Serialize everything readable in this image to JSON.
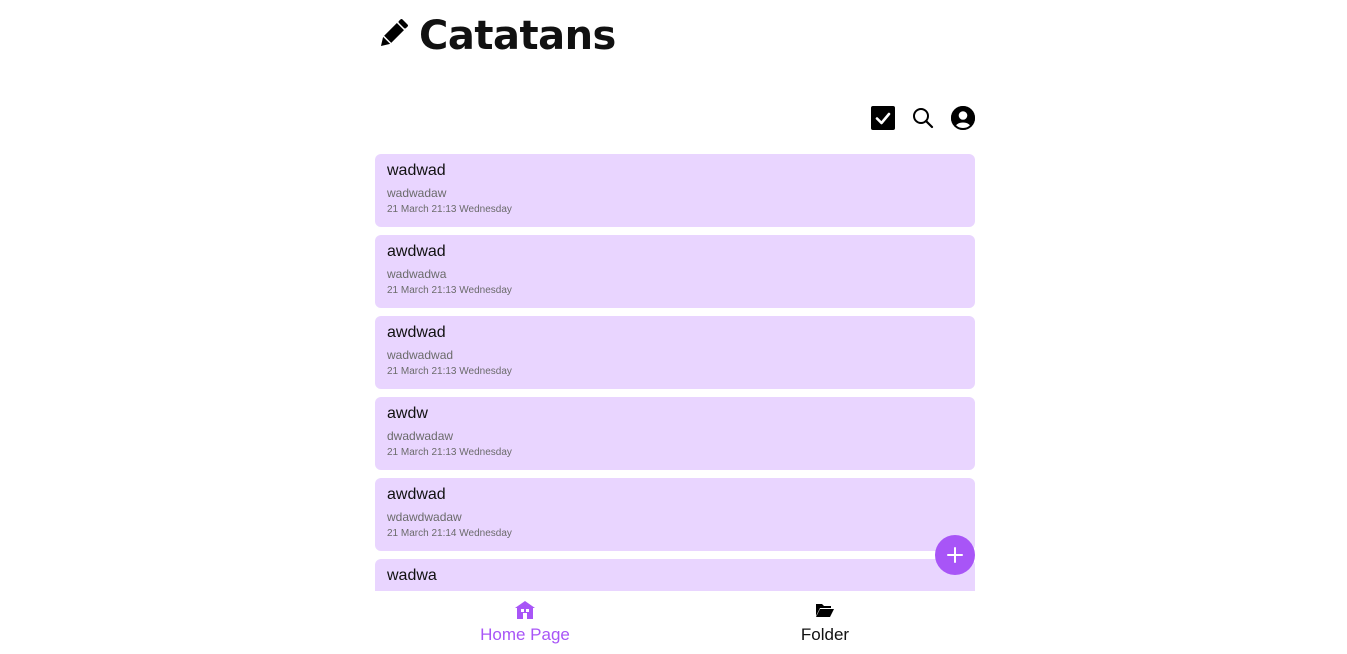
{
  "header": {
    "title": "Catatans",
    "icon": "pencil-icon"
  },
  "toolbar": {
    "icons": [
      "checkbox-icon",
      "search-icon",
      "user-account-icon"
    ]
  },
  "notes": [
    {
      "title": "wadwad",
      "body": "wadwadaw",
      "date": "21 March 21:13 Wednesday"
    },
    {
      "title": "awdwad",
      "body": "wadwadwa",
      "date": "21 March 21:13 Wednesday"
    },
    {
      "title": "awdwad",
      "body": "wadwadwad",
      "date": "21 March 21:13 Wednesday"
    },
    {
      "title": "awdw",
      "body": "dwadwadaw",
      "date": "21 March 21:13 Wednesday"
    },
    {
      "title": "awdwad",
      "body": "wdawdwadaw",
      "date": "21 March 21:14 Wednesday"
    },
    {
      "title": "wadwa",
      "body": "",
      "date": ""
    }
  ],
  "fab": {
    "icon": "plus-icon"
  },
  "nav": {
    "home_label": "Home Page",
    "folder_label": "Folder"
  },
  "colors": {
    "accent": "#a855f7",
    "note_bg": "#e9d5ff"
  }
}
